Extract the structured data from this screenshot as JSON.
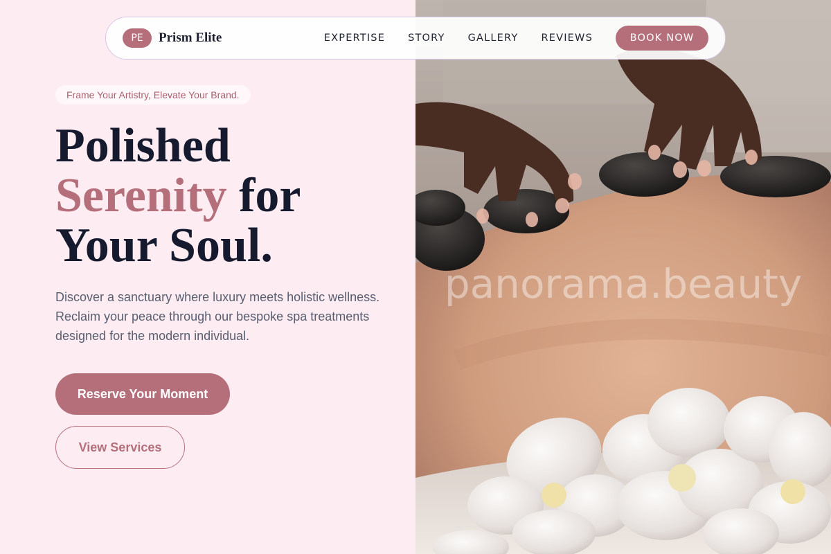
{
  "brand": {
    "initials": "PE",
    "name": "Prism Elite"
  },
  "nav": {
    "links": [
      "EXPERTISE",
      "STORY",
      "GALLERY",
      "REVIEWS"
    ],
    "cta": "BOOK NOW"
  },
  "hero": {
    "tagline": "Frame Your Artistry, Elevate Your Brand.",
    "headline": {
      "line1": "Polished",
      "accent": "Serenity",
      "line2_rest": " for",
      "line3": "Your Soul."
    },
    "description": "Discover a sanctuary where luxury meets holistic wellness. Reclaim your peace through our bespoke spa treatments designed for the modern individual.",
    "primary_button": "Reserve Your Moment",
    "secondary_button": "View Services"
  },
  "image": {
    "watermark": "panorama.beauty"
  },
  "colors": {
    "accent": "#b46f7b",
    "page_background": "#fdedf2",
    "heading": "#161a2e",
    "body_text": "#585e70"
  }
}
